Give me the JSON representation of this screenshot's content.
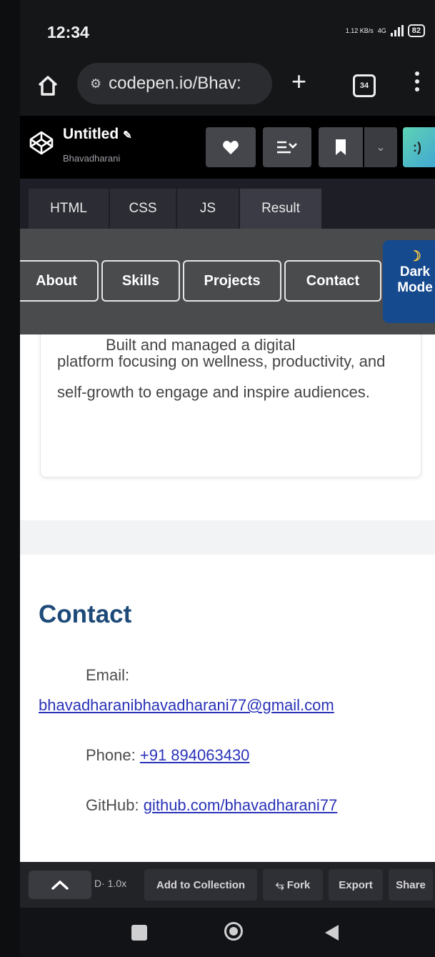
{
  "status_bar": {
    "time": "12:34",
    "net_speed": "1.12 KB/s",
    "network": "4G",
    "battery": "82"
  },
  "browser": {
    "url": "codepen.io/Bhav:",
    "tab_count": "34"
  },
  "codepen": {
    "title": "Untitled",
    "author": "Bhavadharani",
    "avatar_glyph": ":)"
  },
  "editor_tabs": [
    "HTML",
    "CSS",
    "JS",
    "Result"
  ],
  "site_nav": {
    "about": "About",
    "skills": "Skills",
    "projects": "Projects",
    "contact": "Contact",
    "dark_mode_line1": "Dark",
    "dark_mode_line2": "Mode"
  },
  "project_card": {
    "text_partial": "Built and managed a digital",
    "text": "platform focusing on wellness, productivity, and self-growth to engage and inspire audiences."
  },
  "contact": {
    "heading": "Contact",
    "email_label": "Email:",
    "email": "bhavadharanibhavadharani77@gmail.com",
    "phone_label": "Phone:",
    "phone": "+91 894063430",
    "github_label": "GitHub:",
    "github": "github.com/bhavadharani77"
  },
  "bottom_bar": {
    "zoom": "1.0x",
    "add_to_collection": "Add to Collection",
    "fork": "Fork",
    "export": "Export",
    "share": "Share"
  },
  "colors": {
    "accent_blue": "#1d4a78",
    "dark_mode_button": "#164a8e",
    "link": "#2a33b8"
  }
}
